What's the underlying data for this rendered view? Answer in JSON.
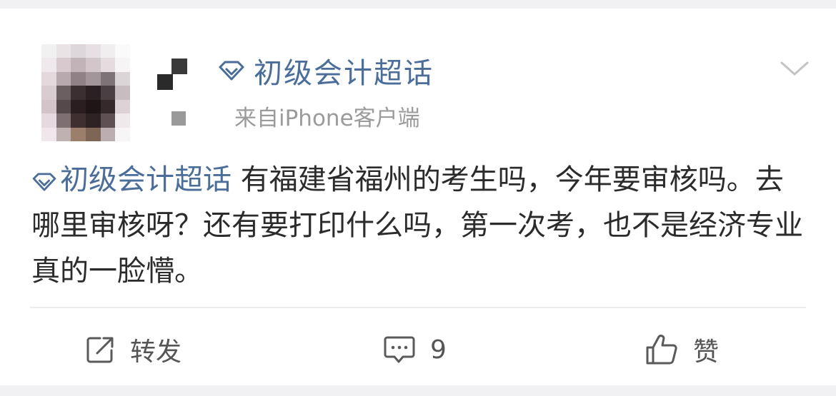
{
  "post": {
    "super_topic": "初级会计超话",
    "source": "来自iPhone客户端",
    "body": {
      "topic": "初级会计超话",
      "text": " 有福建省福州的考生吗，今年要审核吗。去哪里审核呀？还有要打印什么吗，第一次考，也不是经济专业真的一脸懵。"
    },
    "actions": {
      "forward_label": "转发",
      "comment_count": "9",
      "like_label": "赞"
    }
  },
  "colors": {
    "link": "#4a6d9a",
    "text": "#2b2b2b",
    "secondary": "#9b9b9b",
    "background": "#f1f1f3"
  },
  "icons": [
    "diamond-icon",
    "chevron-down-icon",
    "forward-icon",
    "comment-icon",
    "like-icon"
  ]
}
